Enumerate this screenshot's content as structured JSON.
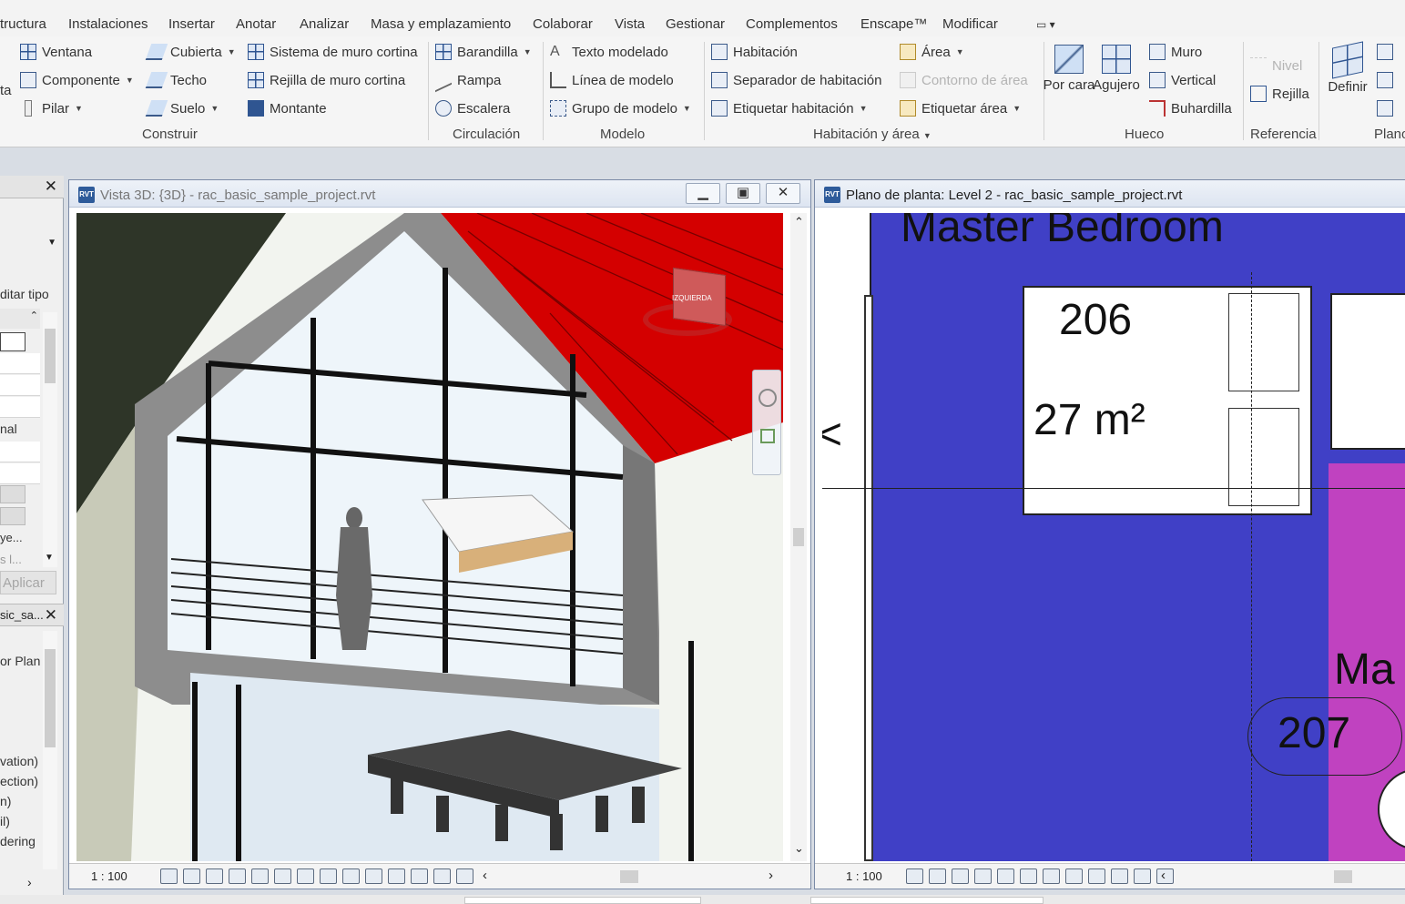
{
  "menu": [
    "tructura",
    "Instalaciones",
    "Insertar",
    "Anotar",
    "Analizar",
    "Masa y emplazamiento",
    "Colaborar",
    "Vista",
    "Gestionar",
    "Complementos",
    "Enscape™",
    "Modificar"
  ],
  "ribbon": {
    "build": {
      "left_cut": "ta",
      "items": [
        "Ventana",
        "Componente",
        "Pilar",
        "Cubierta",
        "Techo",
        "Suelo",
        "Sistema de muro cortina",
        "Rejilla de muro cortina",
        "Montante"
      ],
      "label": "Construir"
    },
    "circulation": {
      "items": [
        "Barandilla",
        "Rampa",
        "Escalera"
      ],
      "label": "Circulación"
    },
    "model": {
      "items": [
        "Texto modelado",
        "Línea de modelo",
        "Grupo de modelo"
      ],
      "label": "Modelo"
    },
    "room": {
      "items": [
        "Habitación",
        "Separador de habitación",
        "Etiquetar habitación",
        "Área",
        "Contorno de área",
        "Etiquetar área"
      ],
      "label": "Habitación y área"
    },
    "opening": {
      "items": [
        "Por cara",
        "Agujero",
        "Muro",
        "Vertical",
        "Buhardilla"
      ],
      "label": "Hueco"
    },
    "reference": {
      "items": [
        "Nivel",
        "Rejilla"
      ],
      "label": "Referencia"
    },
    "plane": {
      "items": [
        "Definir"
      ],
      "label": "Plano"
    }
  },
  "left_panel": {
    "edit_type": "ditar tipo",
    "row_nal": "nal",
    "row_ye": "ye...",
    "row_sl": "s l...",
    "apply": "Aplicar",
    "browser_title": "sic_sa...",
    "browser_items": [
      "or Plan",
      "vation)",
      "ection)",
      "n)",
      "il)",
      "dering"
    ]
  },
  "view3d": {
    "title": "Vista 3D: {3D} - rac_basic_sample_project.rvt",
    "scale": "1 : 100",
    "viewcube_label": "IZQUIERDA"
  },
  "plan": {
    "title": "Plano de planta: Level 2 - rac_basic_sample_project.rvt",
    "scale": "1 : 100",
    "room_name": "Master Bedroom",
    "room_number": "206",
    "room_area": "27 m²",
    "room2_name": "Ma",
    "room2_number": "207",
    "left_glyph": "<"
  }
}
